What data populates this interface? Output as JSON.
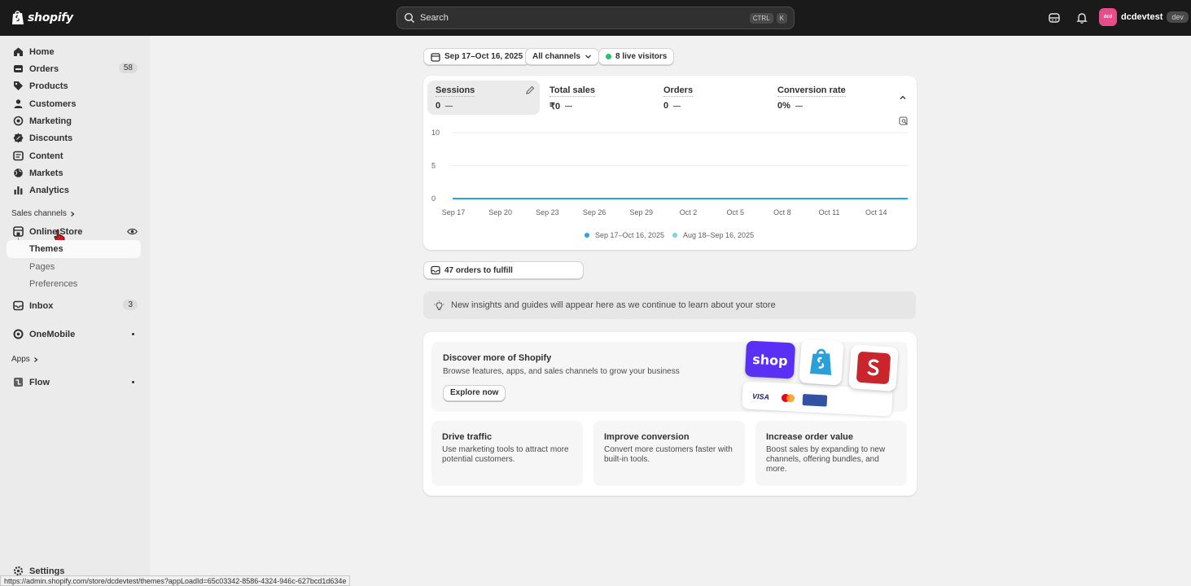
{
  "brand": {
    "logo_text": "shopify"
  },
  "search": {
    "placeholder": "Search",
    "shortcut_1": "CTRL",
    "shortcut_2": "K"
  },
  "account": {
    "avatar_initials": "dcd",
    "store_name": "dcdevtest",
    "badge": "dev",
    "avatar_color": "#e74d8a"
  },
  "sidebar": {
    "items": [
      {
        "label": "Home"
      },
      {
        "label": "Orders",
        "badge": "58"
      },
      {
        "label": "Products"
      },
      {
        "label": "Customers"
      },
      {
        "label": "Marketing"
      },
      {
        "label": "Discounts"
      },
      {
        "label": "Content"
      },
      {
        "label": "Markets"
      },
      {
        "label": "Analytics"
      }
    ],
    "sales_channels_label": "Sales channels",
    "online_store": {
      "label": "Online Store",
      "sub": [
        "Themes",
        "Pages",
        "Preferences"
      ]
    },
    "inbox": {
      "label": "Inbox",
      "badge": "3"
    },
    "onemobile": {
      "label": "OneMobile"
    },
    "apps_label": "Apps",
    "flow": {
      "label": "Flow"
    },
    "settings": {
      "label": "Settings"
    }
  },
  "status_url": "https://admin.shopify.com/store/dcdevtest/themes?appLoadId=65c03342-8586-4324-946c-627bcd1d634e",
  "filters": {
    "date": "Sep 17–Oct 16, 2025",
    "channels": "All channels",
    "live": "8 live visitors",
    "live_color": "#29c16e"
  },
  "metrics": [
    {
      "label": "Sessions",
      "value": "0"
    },
    {
      "label": "Total sales",
      "value": "₹0"
    },
    {
      "label": "Orders",
      "value": "0"
    },
    {
      "label": "Conversion rate",
      "value": "0%"
    }
  ],
  "chart_data": {
    "type": "line",
    "categories": [
      "Sep 17",
      "Sep 20",
      "Sep 23",
      "Sep 26",
      "Sep 29",
      "Oct 2",
      "Oct 5",
      "Oct 8",
      "Oct 11",
      "Oct 14"
    ],
    "ylim": [
      0,
      10
    ],
    "yticks": [
      "10",
      "5",
      "0"
    ],
    "series": [
      {
        "name": "Sep 17–Oct 16, 2025",
        "values": [
          0,
          0,
          0,
          0,
          0,
          0,
          0,
          0,
          0,
          0
        ],
        "color": "#2aa4e0"
      },
      {
        "name": "Aug 18–Sep 16, 2025",
        "values": [
          0,
          0,
          0,
          0,
          0,
          0,
          0,
          0,
          0,
          0
        ],
        "color": "#7fd3df"
      }
    ],
    "grid": true,
    "legend_position": "bottom"
  },
  "fulfill": {
    "label": "47 orders to fulfill"
  },
  "insight": {
    "text": "New insights and guides will appear here as we continue to learn about your store"
  },
  "discover": {
    "title": "Discover more of Shopify",
    "desc": "Browse features, apps, and sales channels to grow your business",
    "button": "Explore now",
    "tile_shop_text": "shop",
    "card_visa": "VISA"
  },
  "features": [
    {
      "title": "Drive traffic",
      "desc": "Use marketing tools to attract more potential customers."
    },
    {
      "title": "Improve conversion",
      "desc": "Convert more customers faster with built-in tools."
    },
    {
      "title": "Increase order value",
      "desc": "Boost sales by expanding to new channels, offering bundles, and more."
    }
  ]
}
